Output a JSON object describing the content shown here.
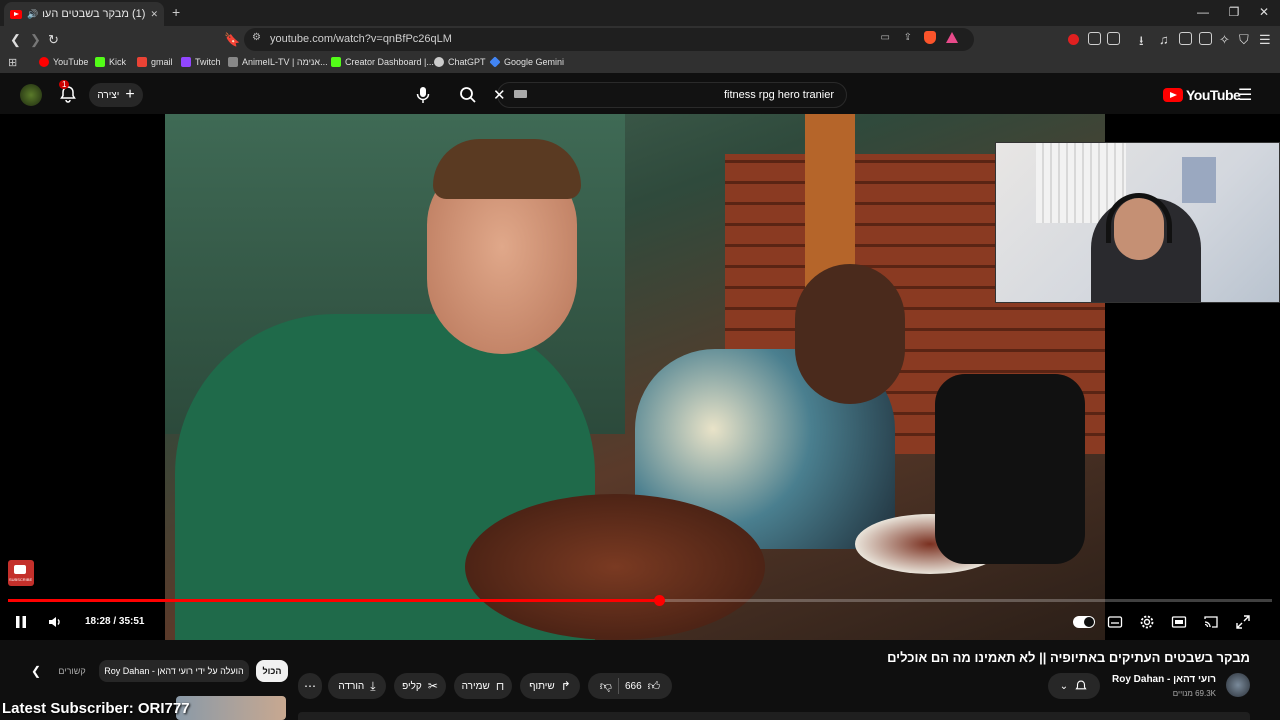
{
  "browser": {
    "tab_title": "(1) מבקר בשבטים העתיקים ב",
    "new_tab": "+",
    "url": "youtube.com/watch?v=qnBfPc26qLM",
    "window_min": "—",
    "window_restore": "❐",
    "window_close": "✕",
    "bookmarks": [
      {
        "label": "YouTube",
        "color": "#ff0000"
      },
      {
        "label": "Kick",
        "color": "#53fc18"
      },
      {
        "label": "gmail",
        "color": "#ea4335"
      },
      {
        "label": "Twitch",
        "color": "#9146ff"
      },
      {
        "label": "AnimeIL-TV | אנימה...",
        "color": "#888888"
      },
      {
        "label": "Creator Dashboard |...",
        "color": "#53fc18"
      },
      {
        "label": "ChatGPT",
        "color": "#cccccc"
      },
      {
        "label": "Google Gemini",
        "color": "#4285f4"
      }
    ]
  },
  "youtube": {
    "logo_text": "YouTube",
    "search_query": "fitness rpg hero tranier",
    "create_label": "יצירה",
    "notification_count": "1"
  },
  "video": {
    "time": "18:28 / 35:51",
    "progress_fraction": 0.515,
    "title": "מבקר בשבטים העתיקים באתיופיה || לא תאמינו מה הם אוכלים",
    "subscribe_badge": "SUBSCRIBE"
  },
  "channel": {
    "name": "Roy Dahan",
    "name_he": "רועי דהאן",
    "subscribers": "69.3K מנויים"
  },
  "actions": {
    "likes": "666",
    "share": "שיתוף",
    "save": "שמירה",
    "clip": "קליפ",
    "download": "הורדה"
  },
  "chips": {
    "all": "הכול",
    "uploaded_by": "Roy Dahan - הועלה על ידי רועי דהאן",
    "related": "קשורים"
  },
  "overlay": {
    "latest_subscriber": "Latest Subscriber: ORI777"
  },
  "colors": {
    "accent": "#ff0000",
    "bg": "#0f0f0f"
  }
}
